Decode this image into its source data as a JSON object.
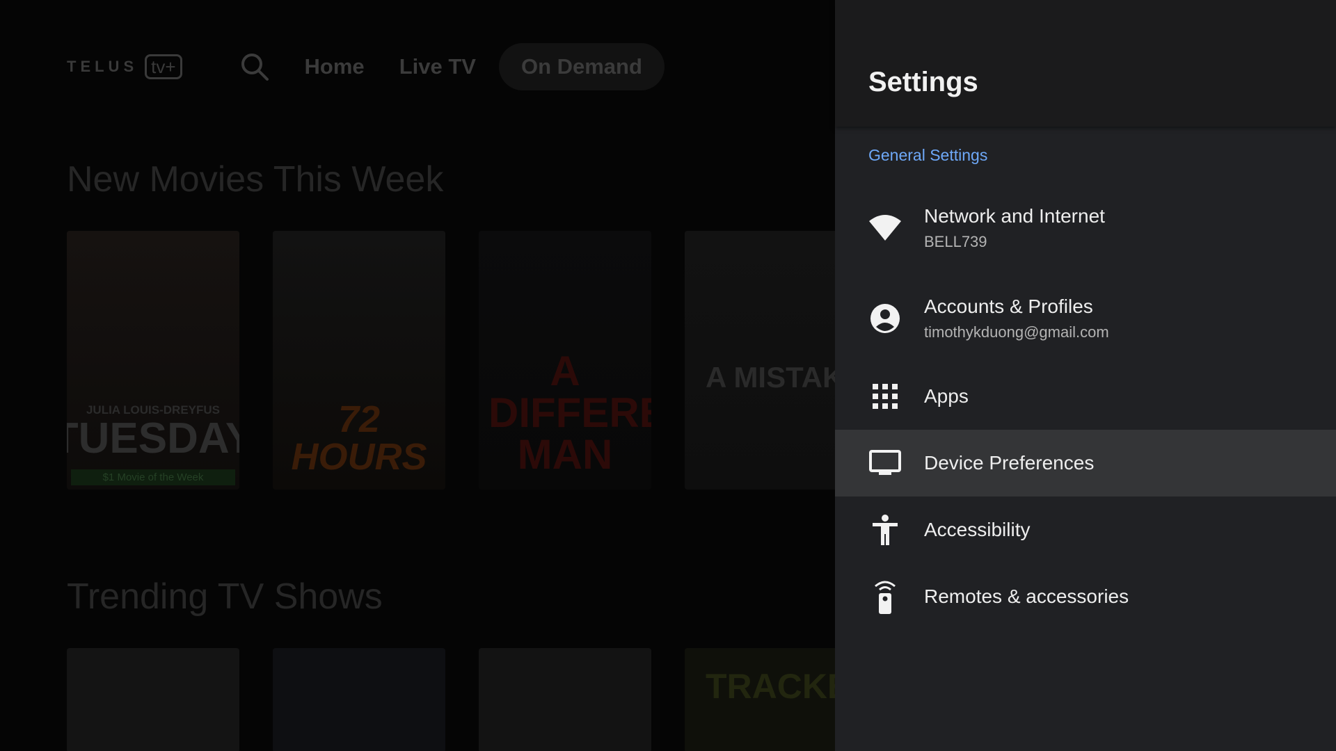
{
  "background_app": {
    "logo": {
      "brand": "TELUS",
      "suffix": "tv+"
    },
    "nav": {
      "home": "Home",
      "live_tv": "Live TV",
      "on_demand": "On Demand"
    },
    "rows": [
      {
        "title": "New Movies This Week",
        "posters": [
          {
            "actor": "JULIA LOUIS-DREYFUS",
            "title": "TUESDAY",
            "badge": "$1 Movie of the Week"
          },
          {
            "title": "72 HOURS"
          },
          {
            "title": "A DIFFERENT MAN"
          },
          {
            "title": "A MISTAKE"
          }
        ]
      },
      {
        "title": "Trending TV Shows",
        "posters": [
          {
            "title": ""
          },
          {
            "title": ""
          },
          {
            "title": ""
          },
          {
            "title": "TRACKER"
          }
        ]
      }
    ]
  },
  "settings": {
    "title": "Settings",
    "section": "General Settings",
    "items": [
      {
        "label": "Network and Internet",
        "sub": "BELL739",
        "icon": "wifi-icon"
      },
      {
        "label": "Accounts & Profiles",
        "sub": "timothykduong@gmail.com",
        "icon": "account-circle-icon"
      },
      {
        "label": "Apps",
        "icon": "apps-grid-icon"
      },
      {
        "label": "Device Preferences",
        "icon": "tv-monitor-icon",
        "focused": true
      },
      {
        "label": "Accessibility",
        "icon": "accessibility-icon"
      },
      {
        "label": "Remotes & accessories",
        "icon": "remote-icon"
      }
    ],
    "colors": {
      "panel": "#202124",
      "focus": "#343537",
      "section_accent": "#6ea8f7"
    }
  }
}
